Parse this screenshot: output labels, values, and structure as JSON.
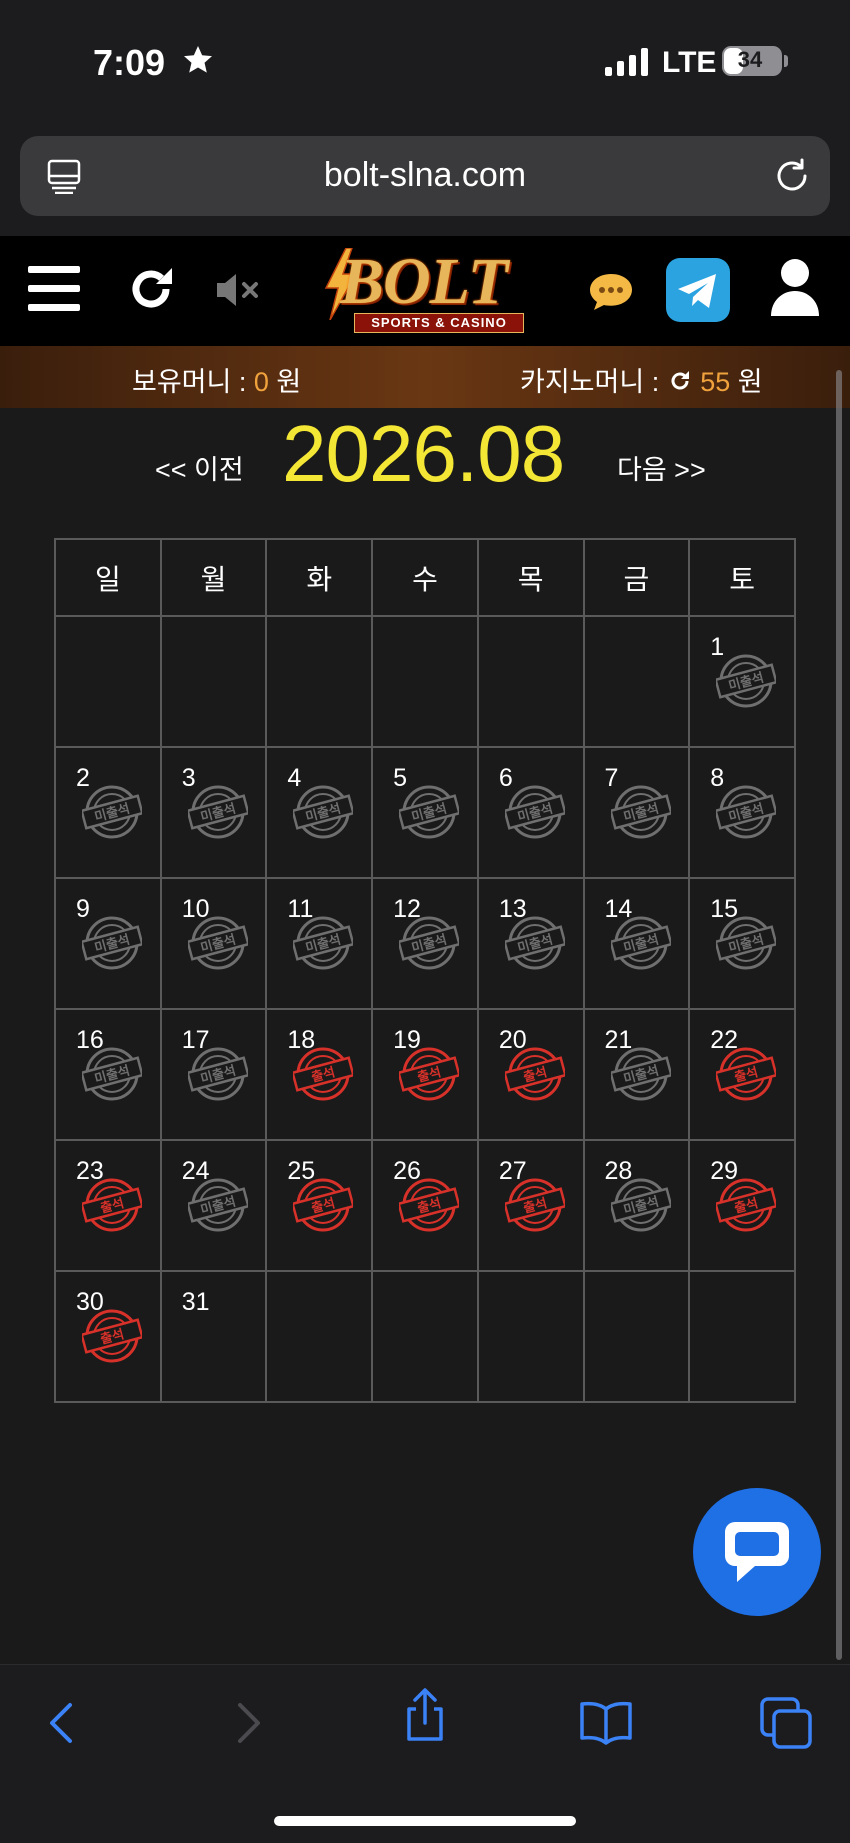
{
  "status_bar": {
    "time": "7:09",
    "network": "LTE",
    "battery": "34",
    "battery_level": 0.34
  },
  "browser": {
    "url": "bolt-slna.com"
  },
  "site": {
    "logo_text": "BOLT",
    "logo_sub": "SPORTS & CASINO",
    "menu_icon": "hamburger-menu-icon",
    "refresh_icon": "refresh-icon",
    "sound_icon": "speaker-muted-icon",
    "chat_icon": "speech-bubble-icon",
    "telegram_icon": "telegram-icon",
    "user_icon": "user-icon"
  },
  "money": {
    "held_label": "보유머니 : ",
    "held_value": "0",
    "held_unit": " 원",
    "casino_label": "카지노머니 : ",
    "casino_value": "55",
    "casino_unit": " 원"
  },
  "calendar": {
    "prev_label": "<< 이전",
    "title": "2026.08",
    "next_label": "다음 >>",
    "weekdays": [
      "일",
      "월",
      "화",
      "수",
      "목",
      "금",
      "토"
    ],
    "weeks": [
      [
        null,
        null,
        null,
        null,
        null,
        null,
        {
          "day": "1",
          "status": "absent"
        }
      ],
      [
        {
          "day": "2",
          "status": "absent"
        },
        {
          "day": "3",
          "status": "absent"
        },
        {
          "day": "4",
          "status": "absent"
        },
        {
          "day": "5",
          "status": "absent"
        },
        {
          "day": "6",
          "status": "absent"
        },
        {
          "day": "7",
          "status": "absent"
        },
        {
          "day": "8",
          "status": "absent"
        }
      ],
      [
        {
          "day": "9",
          "status": "absent"
        },
        {
          "day": "10",
          "status": "absent"
        },
        {
          "day": "11",
          "status": "absent"
        },
        {
          "day": "12",
          "status": "absent"
        },
        {
          "day": "13",
          "status": "absent"
        },
        {
          "day": "14",
          "status": "absent"
        },
        {
          "day": "15",
          "status": "absent"
        }
      ],
      [
        {
          "day": "16",
          "status": "absent"
        },
        {
          "day": "17",
          "status": "absent"
        },
        {
          "day": "18",
          "status": "present"
        },
        {
          "day": "19",
          "status": "present"
        },
        {
          "day": "20",
          "status": "present"
        },
        {
          "day": "21",
          "status": "absent"
        },
        {
          "day": "22",
          "status": "present"
        }
      ],
      [
        {
          "day": "23",
          "status": "present"
        },
        {
          "day": "24",
          "status": "absent"
        },
        {
          "day": "25",
          "status": "present"
        },
        {
          "day": "26",
          "status": "present"
        },
        {
          "day": "27",
          "status": "present"
        },
        {
          "day": "28",
          "status": "absent"
        },
        {
          "day": "29",
          "status": "present"
        }
      ],
      [
        {
          "day": "30",
          "status": "present"
        },
        {
          "day": "31",
          "status": null
        },
        null,
        null,
        null,
        null,
        null
      ]
    ],
    "stamp_present_text": "출석",
    "stamp_absent_text": "미출석",
    "stamp_present_color": "#d8312a",
    "stamp_absent_color": "#6f6f6f"
  },
  "toolbar": {
    "back_icon": "back-chevron-icon",
    "forward_icon": "forward-chevron-icon",
    "share_icon": "share-icon",
    "bookmarks_icon": "book-icon",
    "tabs_icon": "tabs-icon"
  },
  "colors": {
    "accent_yellow": "#f4e635",
    "money_orange": "#f0a23c",
    "chat_blue": "#1f6fe5",
    "ios_blue": "#3b82f6"
  }
}
